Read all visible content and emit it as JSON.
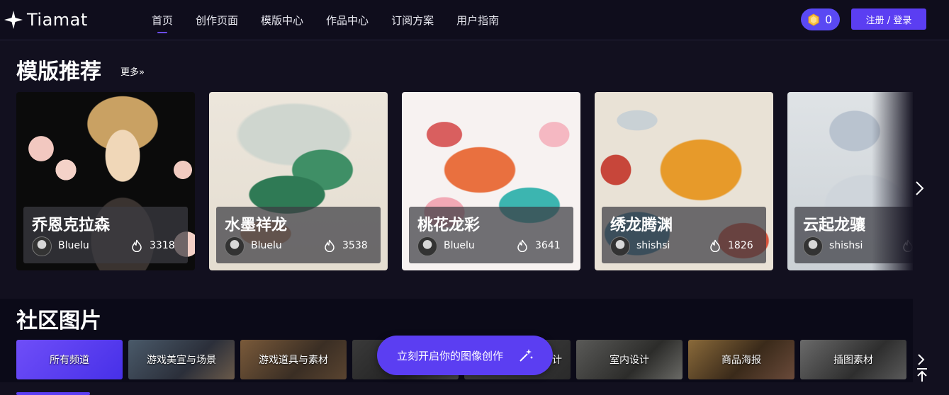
{
  "brand": {
    "name": "Tiamat"
  },
  "nav": [
    {
      "label": "首页",
      "active": true
    },
    {
      "label": "创作页面"
    },
    {
      "label": "模版中心"
    },
    {
      "label": "作品中心"
    },
    {
      "label": "订阅方案"
    },
    {
      "label": "用户指南"
    }
  ],
  "header": {
    "coins": "0",
    "login_label": "注册 / 登录"
  },
  "templates": {
    "title": "模版推荐",
    "more_label": "更多»",
    "cards": [
      {
        "title": "乔恩克拉森",
        "author": "Bluelu",
        "count": "3318"
      },
      {
        "title": "水墨祥龙",
        "author": "Bluelu",
        "count": "3538"
      },
      {
        "title": "桃花龙彩",
        "author": "Bluelu",
        "count": "3641"
      },
      {
        "title": "绣龙腾渊",
        "author": "shishsi",
        "count": "1826"
      },
      {
        "title": "云起龙骧",
        "author": "shishsi",
        "count": ""
      }
    ]
  },
  "community": {
    "title": "社区图片",
    "chips": [
      {
        "label": "所有频道",
        "active": true
      },
      {
        "label": "游戏美宣与场景"
      },
      {
        "label": "游戏道具与素材"
      },
      {
        "label": ""
      },
      {
        "label": "计"
      },
      {
        "label": "室内设计"
      },
      {
        "label": "商品海报"
      },
      {
        "label": "插图素材"
      }
    ],
    "cta_label": "立刻开启你的图像创作"
  },
  "colors": {
    "accent": "#5b3ef2",
    "background": "#12101f"
  }
}
